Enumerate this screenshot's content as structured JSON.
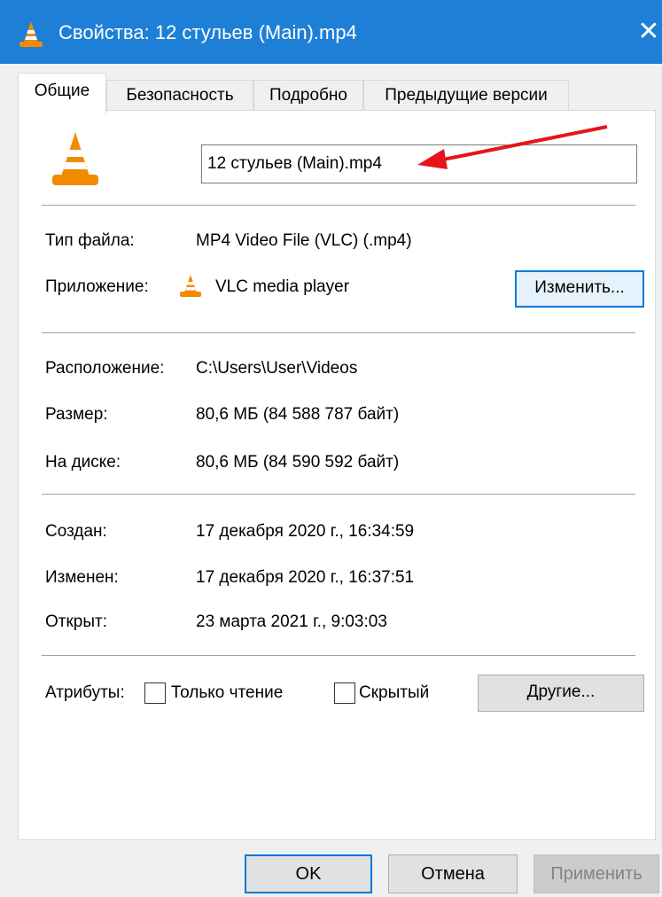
{
  "window": {
    "title": "Свойства: 12 стульев (Main).mp4",
    "close_glyph": "✕"
  },
  "tabs": [
    {
      "label": "Общие",
      "active": true
    },
    {
      "label": "Безопасность",
      "active": false
    },
    {
      "label": "Подробно",
      "active": false
    },
    {
      "label": "Предыдущие версии",
      "active": false
    }
  ],
  "general": {
    "file_name": "12 стульев (Main).mp4",
    "file_type_label": "Тип файла:",
    "file_type_value": "MP4 Video File (VLC) (.mp4)",
    "app_label": "Приложение:",
    "app_value": "VLC media player",
    "change_button": "Изменить...",
    "location_label": "Расположение:",
    "location_value": "C:\\Users\\User\\Videos",
    "size_label": "Размер:",
    "size_value": "80,6 МБ (84 588 787 байт)",
    "disk_label": "На диске:",
    "disk_value": "80,6 МБ (84 590 592 байт)",
    "created_label": "Создан:",
    "created_value": "17 декабря 2020 г., 16:34:59",
    "modified_label": "Изменен:",
    "modified_value": "17 декабря 2020 г., 16:37:51",
    "opened_label": "Открыт:",
    "opened_value": "23 марта 2021 г., 9:03:03",
    "attributes_label": "Атрибуты:",
    "readonly_label": "Только чтение",
    "readonly_checked": false,
    "hidden_label": "Скрытый",
    "hidden_checked": false,
    "other_button": "Другие..."
  },
  "footer": {
    "ok": "OK",
    "cancel": "Отмена",
    "apply": "Применить"
  },
  "colors": {
    "titlebar": "#1e7fd6",
    "focus_border": "#0078d7",
    "annotation_arrow": "#e8141b",
    "vlc_orange": "#f28a00"
  }
}
